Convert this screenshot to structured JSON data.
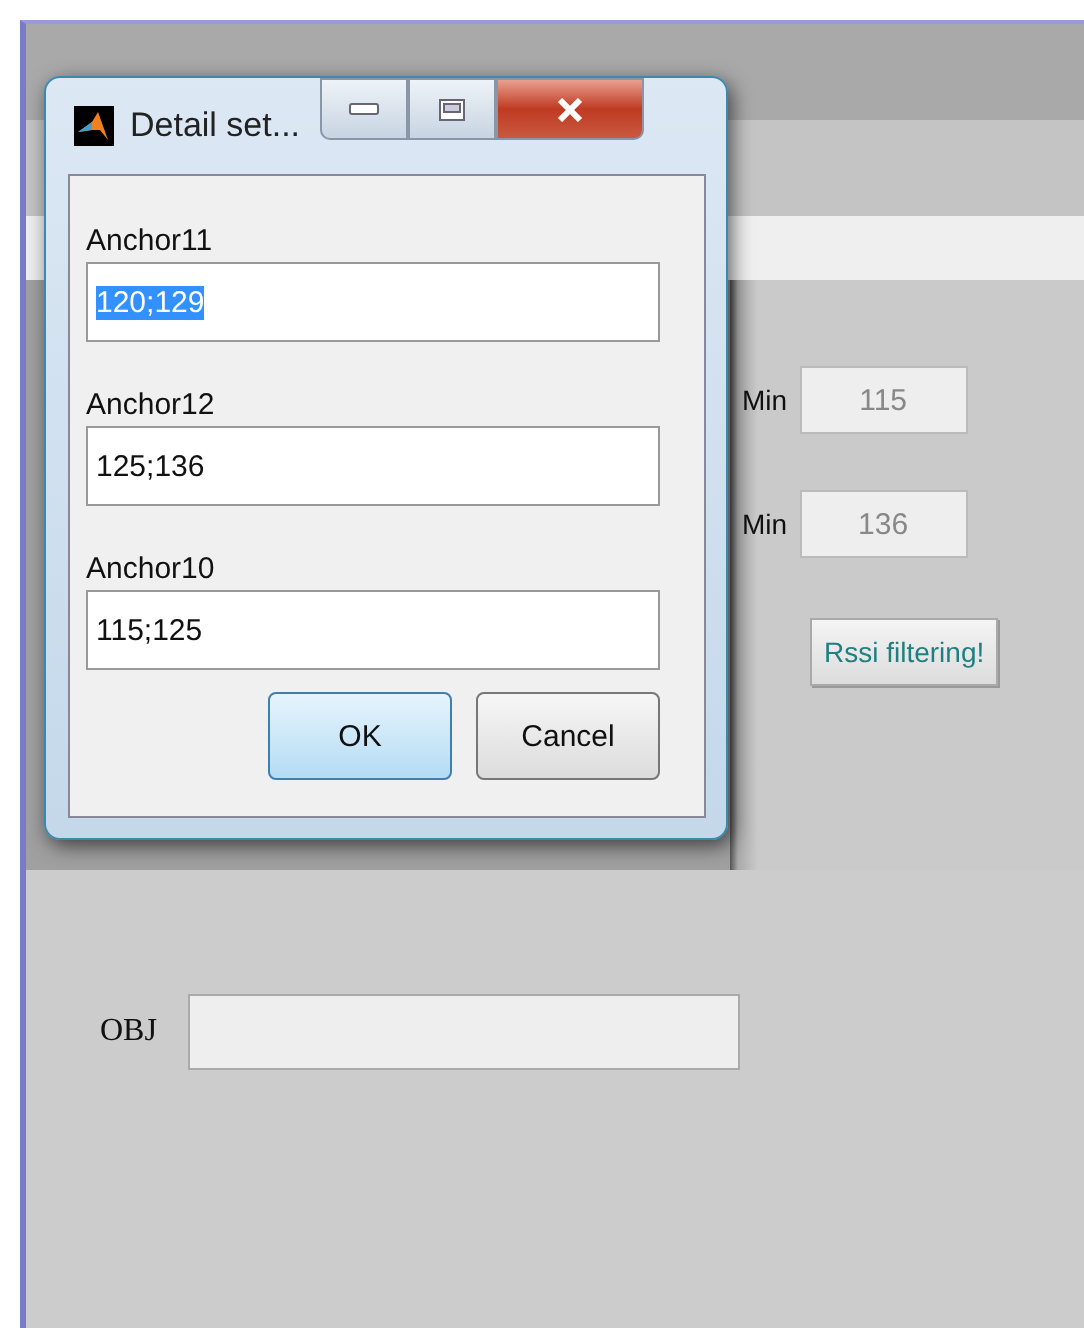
{
  "main_window": {
    "rows": [
      {
        "label": "Min",
        "value": "115",
        "disabled": true
      },
      {
        "label": "Min",
        "value": "136",
        "disabled": true
      }
    ],
    "filter_button": "Rssi filtering!",
    "obj": {
      "label": "OBJ",
      "value_disabled": false
    }
  },
  "dialog": {
    "title": "Detail set...",
    "fields": [
      {
        "label": "Anchor11",
        "value": "120;129",
        "text_selected": true
      },
      {
        "label": "Anchor12",
        "value": "125;136",
        "text_selected": false
      },
      {
        "label": "Anchor10",
        "value": "115;125",
        "text_selected": false
      }
    ],
    "buttons": [
      {
        "label": "OK",
        "default": true
      },
      {
        "label": "Cancel",
        "default": false
      }
    ]
  }
}
